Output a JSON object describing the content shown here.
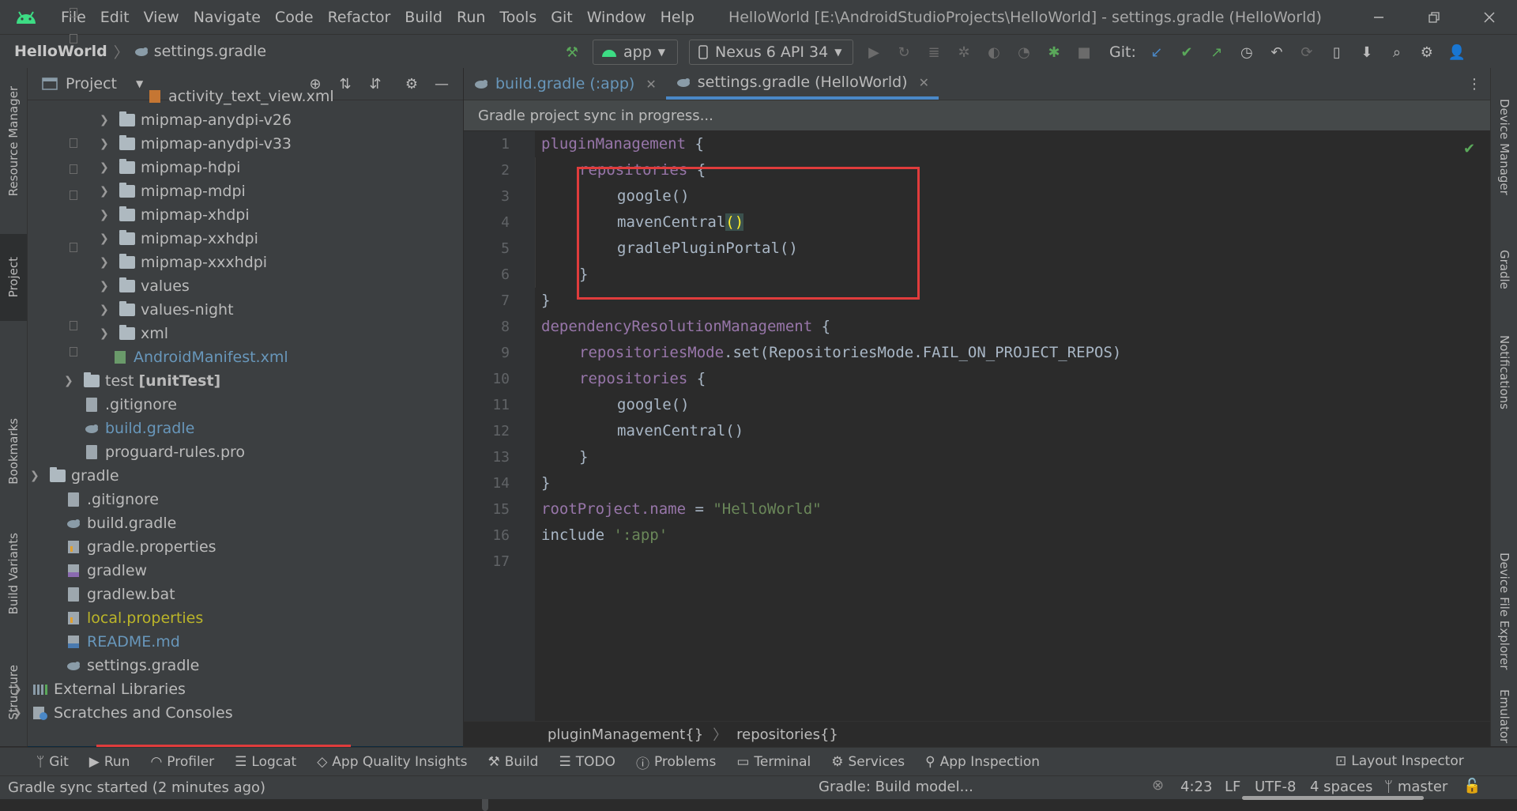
{
  "menubar": {
    "items": [
      "File",
      "Edit",
      "View",
      "Navigate",
      "Code",
      "Refactor",
      "Build",
      "Run",
      "Tools",
      "Git",
      "Window",
      "Help"
    ],
    "window_title": "HelloWorld [E:\\AndroidStudioProjects\\HelloWorld] - settings.gradle (HelloWorld)"
  },
  "navbar": {
    "project": "HelloWorld",
    "file": "settings.gradle",
    "run_config": "app",
    "device": "Nexus 6 API 34",
    "git_label": "Git:"
  },
  "left_stripe": {
    "resource_manager": "Resource Manager",
    "project": "Project",
    "bookmarks": "Bookmarks",
    "build_variants": "Build Variants",
    "structure": "Structure"
  },
  "right_stripe": {
    "device_manager": "Device Manager",
    "gradle": "Gradle",
    "notifications": "Notifications",
    "device_file_explorer": "Device File Explorer",
    "emulator": "Emulator"
  },
  "project_panel": {
    "title": "Project",
    "tree": [
      {
        "label": "activity_text_view.xml",
        "icon": "xml-layout-icon",
        "arrow": false,
        "color": "normal"
      },
      {
        "label": "mipmap-anydpi-v26",
        "icon": "folder-icon",
        "arrow": true,
        "color": "normal"
      },
      {
        "label": "mipmap-anydpi-v33",
        "icon": "folder-icon",
        "arrow": true,
        "color": "normal"
      },
      {
        "label": "mipmap-hdpi",
        "icon": "folder-icon",
        "arrow": true,
        "color": "normal"
      },
      {
        "label": "mipmap-mdpi",
        "icon": "folder-icon",
        "arrow": true,
        "color": "normal"
      },
      {
        "label": "mipmap-xhdpi",
        "icon": "folder-icon",
        "arrow": true,
        "color": "normal"
      },
      {
        "label": "mipmap-xxhdpi",
        "icon": "folder-icon",
        "arrow": true,
        "color": "normal"
      },
      {
        "label": "mipmap-xxxhdpi",
        "icon": "folder-icon",
        "arrow": true,
        "color": "normal"
      },
      {
        "label": "values",
        "icon": "folder-icon",
        "arrow": true,
        "color": "normal"
      },
      {
        "label": "values-night",
        "icon": "folder-icon",
        "arrow": true,
        "color": "normal"
      },
      {
        "label": "xml",
        "icon": "folder-icon",
        "arrow": true,
        "color": "normal"
      },
      {
        "label": "AndroidManifest.xml",
        "icon": "manifest-icon",
        "arrow": false,
        "color": "blue"
      },
      {
        "label": "test",
        "suffix": "[unitTest]",
        "icon": "folder-icon",
        "arrow": true,
        "color": "normal"
      },
      {
        "label": ".gitignore",
        "icon": "file-icon",
        "arrow": false,
        "color": "normal"
      },
      {
        "label": "build.gradle",
        "icon": "gradle-icon",
        "arrow": false,
        "color": "blue"
      },
      {
        "label": "proguard-rules.pro",
        "icon": "file-icon",
        "arrow": false,
        "color": "normal"
      },
      {
        "label": "gradle",
        "icon": "folder-icon",
        "arrow": true,
        "color": "normal"
      },
      {
        "label": ".gitignore",
        "icon": "file-icon",
        "arrow": false,
        "color": "normal"
      },
      {
        "label": "build.gradle",
        "icon": "gradle-icon",
        "arrow": false,
        "color": "normal"
      },
      {
        "label": "gradle.properties",
        "icon": "properties-icon",
        "arrow": false,
        "color": "normal"
      },
      {
        "label": "gradlew",
        "icon": "script-icon",
        "arrow": false,
        "color": "normal"
      },
      {
        "label": "gradlew.bat",
        "icon": "file-icon",
        "arrow": false,
        "color": "normal"
      },
      {
        "label": "local.properties",
        "icon": "properties-icon",
        "arrow": false,
        "color": "yellow"
      },
      {
        "label": "README.md",
        "icon": "markdown-icon",
        "arrow": false,
        "color": "blue"
      },
      {
        "label": "settings.gradle",
        "icon": "gradle-icon",
        "arrow": false,
        "color": "normal"
      },
      {
        "label": "External Libraries",
        "icon": "libraries-icon",
        "arrow": true,
        "color": "normal"
      },
      {
        "label": "Scratches and Consoles",
        "icon": "scratches-icon",
        "arrow": true,
        "color": "normal"
      }
    ]
  },
  "editor": {
    "tabs": [
      {
        "label": "build.gradle (:app)",
        "active": false
      },
      {
        "label": "settings.gradle (HelloWorld)",
        "active": true
      }
    ],
    "banner": "Gradle project sync in progress...",
    "line_numbers": [
      "1",
      "2",
      "3",
      "4",
      "5",
      "6",
      "7",
      "8",
      "9",
      "10",
      "11",
      "12",
      "13",
      "14",
      "15",
      "16",
      "17"
    ],
    "code": {
      "l1a": "pluginManagement",
      "l1b": " {",
      "l2a": "repositories",
      "l2b": " {",
      "l3": "google()",
      "l4a": "mavenCentral",
      "l4b": "()",
      "l5": "gradlePluginPortal()",
      "l6": "}",
      "l7": "}",
      "l8a": "dependencyResolutionManagement",
      "l8b": " {",
      "l9a": "repositoriesMode",
      "l9b": ".set(RepositoriesMode.FAIL_ON_PROJECT_REPOS)",
      "l10a": "repositories",
      "l10b": " {",
      "l11": "google()",
      "l12": "mavenCentral()",
      "l13": "}",
      "l14": "}",
      "l15a": "rootProject.name",
      "l15b": " = ",
      "l15c": "\"HelloWorld\"",
      "l16a": "include ",
      "l16b": "':app'"
    },
    "breadcrumb": [
      "pluginManagement{}",
      "repositories{}"
    ]
  },
  "tool_windows": [
    "Git",
    "Run",
    "Profiler",
    "Logcat",
    "App Quality Insights",
    "Build",
    "TODO",
    "Problems",
    "Terminal",
    "Services",
    "App Inspection"
  ],
  "layout_inspector": "Layout Inspector",
  "status": {
    "message": "Gradle sync started (2 minutes ago)",
    "task": "Gradle: Build model...",
    "position": "4:23",
    "line_sep": "LF",
    "encoding": "UTF-8",
    "indent": "4 spaces",
    "branch": "master"
  },
  "colors": {
    "highlight_box": "#e03c3c",
    "selection": "#0d293e",
    "keyword": "#9876aa",
    "string": "#6a8759"
  }
}
